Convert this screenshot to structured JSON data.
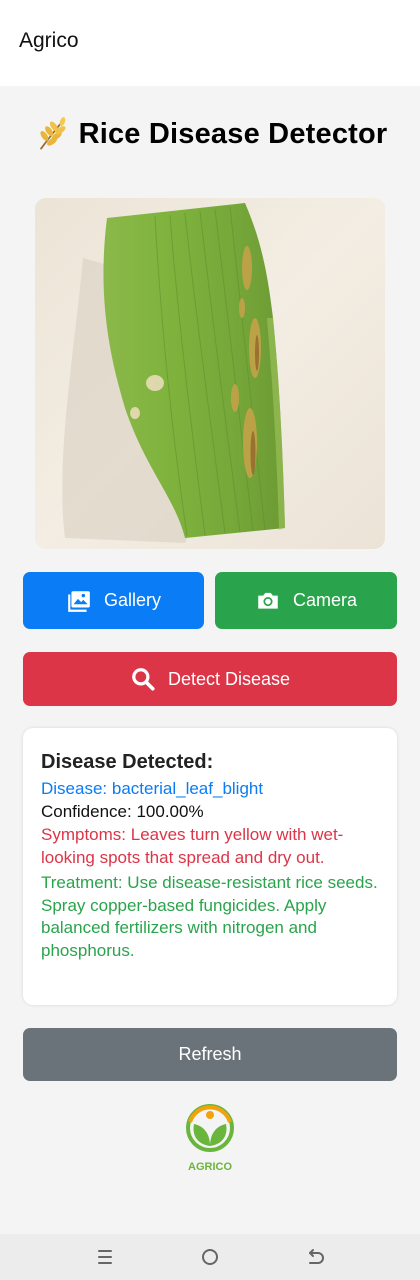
{
  "app_bar": {
    "title": "Agrico"
  },
  "header": {
    "icon": "rice-icon",
    "title": "Rice Disease Detector"
  },
  "preview_image": {
    "description_icon": "rice-leaf-photo"
  },
  "buttons": {
    "gallery": {
      "label": "Gallery",
      "icon": "image-icon"
    },
    "camera": {
      "label": "Camera",
      "icon": "camera-icon"
    },
    "detect": {
      "label": "Detect Disease",
      "icon": "search-icon"
    },
    "refresh": {
      "label": "Refresh"
    }
  },
  "result": {
    "heading": "Disease Detected:",
    "disease": "Disease: bacterial_leaf_blight",
    "confidence": "Confidence: 100.00%",
    "symptoms": "Symptoms: Leaves turn yellow with wet-looking spots that spread and dry out.",
    "treatment": "Treatment: Use disease-resistant rice seeds. Spray copper-based fungicides. Apply balanced fertilizers with nitrogen and phosphorus."
  },
  "logo": {
    "text": "AGRICO"
  },
  "colors": {
    "primary_blue": "#0a7cf5",
    "success_green": "#2aa44c",
    "danger_red": "#dc3548",
    "secondary_gray": "#6b737a",
    "logo_green": "#6ab63d",
    "logo_orange": "#f2a20d"
  },
  "system_nav": {
    "icons": [
      "recent-apps-icon",
      "home-icon",
      "back-icon"
    ]
  }
}
